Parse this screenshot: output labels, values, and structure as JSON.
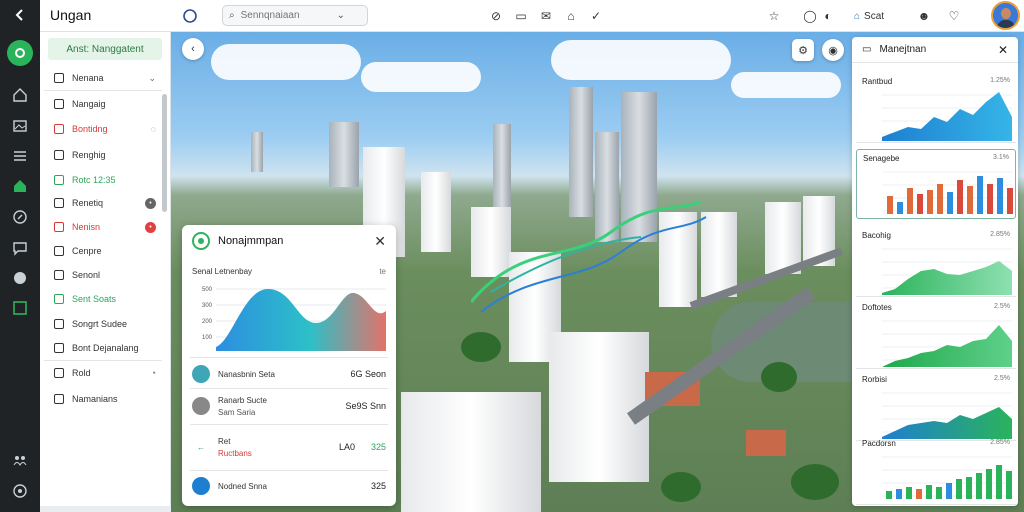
{
  "app": {
    "title": "Ungan"
  },
  "topbar": {
    "search_placeholder": "Sennqnaiaan",
    "chip_label": "Scat"
  },
  "sidebar": {
    "header": "Anst: Nanggatent",
    "items": [
      {
        "label": "Nenana",
        "trail": "⌄",
        "color": "#333333"
      },
      {
        "label": "Nangaig",
        "color": "#333333"
      },
      {
        "label": "Bontidng",
        "trail": "◌",
        "color": "#d93838"
      },
      {
        "label": "Renghig",
        "color": "#333333"
      },
      {
        "label": "Rotc 12:35",
        "color": "#2aa65a"
      },
      {
        "label": "Renetiq",
        "dot": "#666666",
        "color": "#333333"
      },
      {
        "label": "Nenisn",
        "dot": "#e04040",
        "color": "#d93838"
      },
      {
        "label": "Cenpre",
        "color": "#333333"
      },
      {
        "label": "Senonl",
        "color": "#333333"
      },
      {
        "label": "Sent Soats",
        "color": "#2aa65a"
      },
      {
        "label": "Songrt Sudee",
        "color": "#333333"
      },
      {
        "label": "Bont Dejanalang",
        "color": "#333333"
      },
      {
        "label": "Rold",
        "trail": "◔",
        "color": "#333333"
      },
      {
        "label": "Namanians",
        "color": "#333333"
      }
    ]
  },
  "float_panel": {
    "title": "Nonajmmpan",
    "subtitle": "Senal Letnenbay",
    "subtitle_right": "te",
    "chart_yticks": [
      "500",
      "300",
      "200",
      "100"
    ],
    "rows": [
      {
        "label": "Nanasbnin Seta",
        "value": "6G Seon",
        "icon_color": "#3fa6b8"
      },
      {
        "label": "Ranarb Sucte",
        "sublabel": "Sam Saria",
        "value": "Se9S Snn",
        "icon_color": "#888888"
      },
      {
        "label": "Ret",
        "sublabel": "Ructbans",
        "value": "LA0",
        "value2": "325",
        "icon_color": "#ffffff"
      },
      {
        "label": "Nodned Snna",
        "value": "325",
        "icon_color": "#1e7fd0"
      }
    ]
  },
  "right_panel": {
    "title": "Manejtnan",
    "cards": [
      {
        "title": "Rantbud",
        "value": "1.25%"
      },
      {
        "title": "Senagebe",
        "value": "3.1%"
      },
      {
        "title": "Bacohig",
        "value": "2.85%"
      },
      {
        "title": "Doftotes",
        "value": "2.5%"
      },
      {
        "title": "Rorbisi",
        "value": "2.5%"
      },
      {
        "title": "Pacdorsn",
        "value": "2.85%"
      }
    ]
  },
  "colors": {
    "accent": "#2bb35b",
    "rail": "#1f2326",
    "danger": "#e04040"
  }
}
